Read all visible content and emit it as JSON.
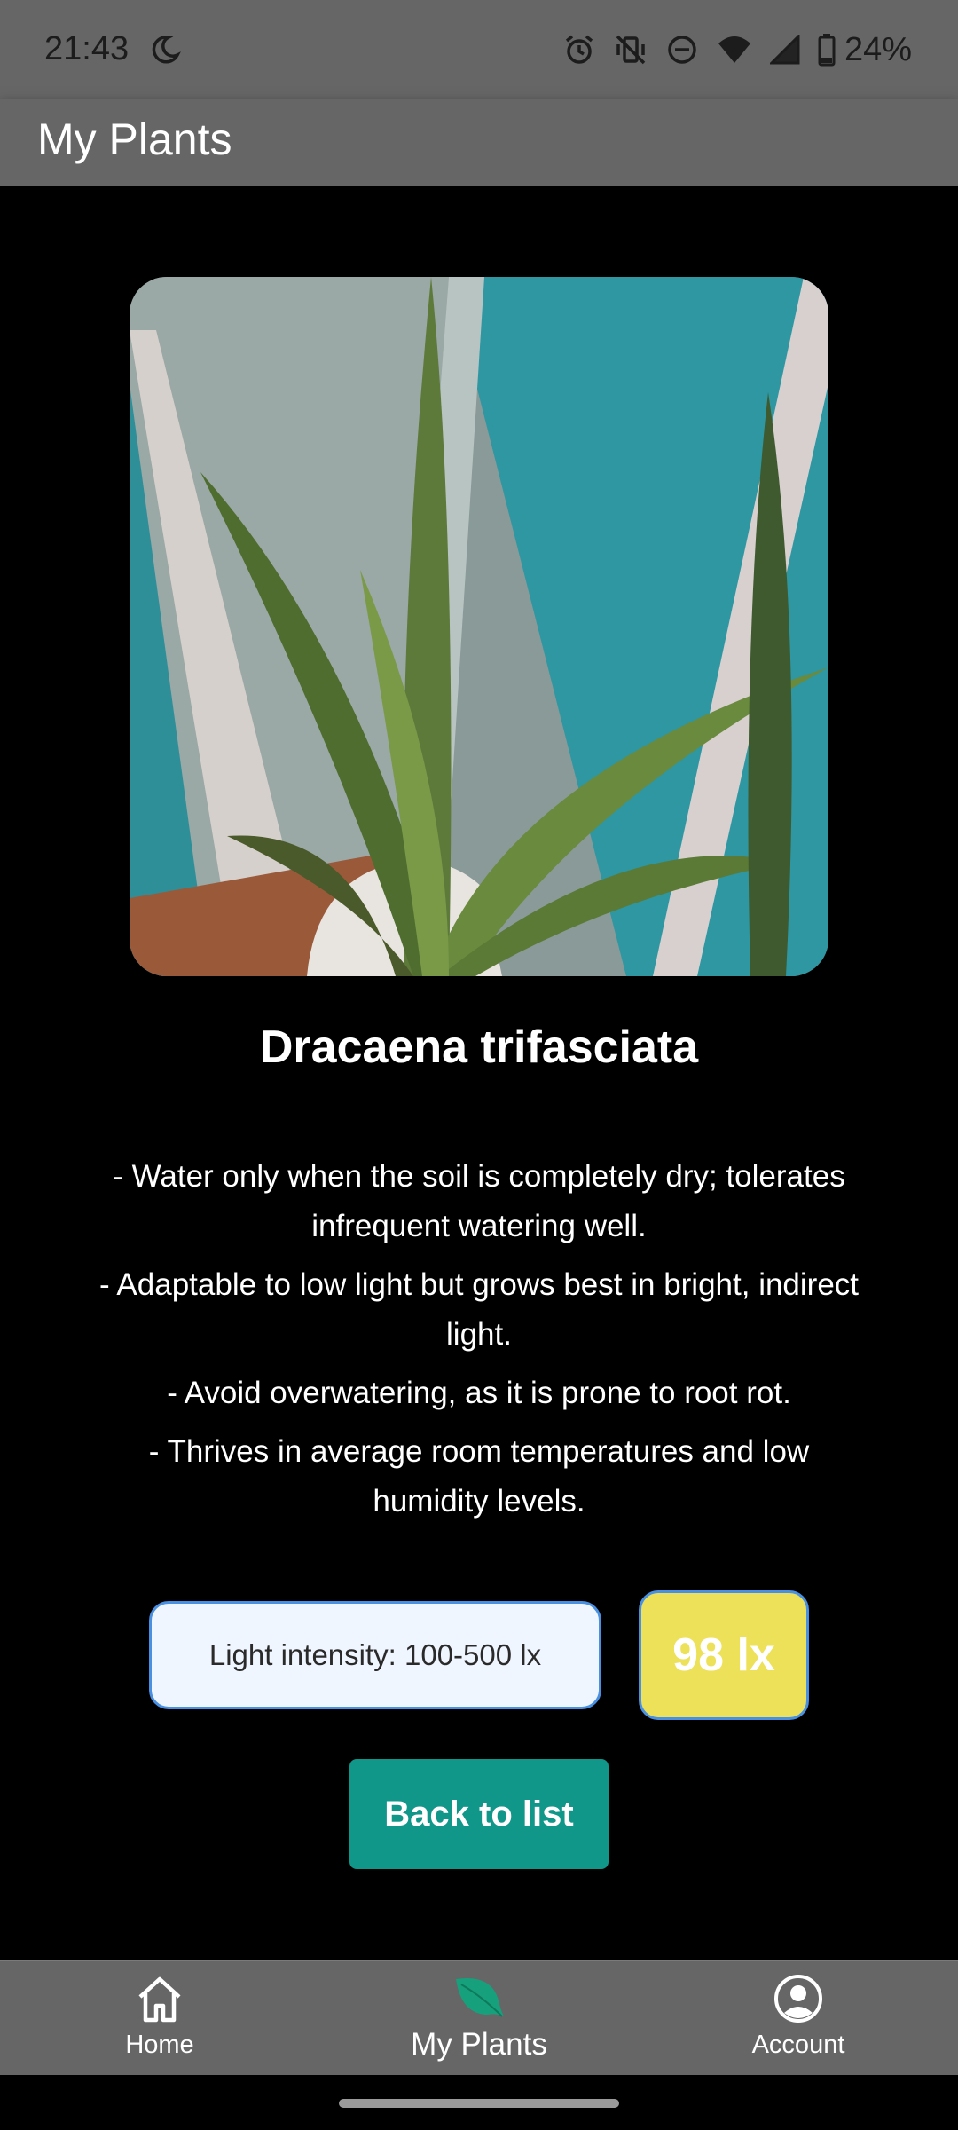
{
  "status_bar": {
    "time": "21:43",
    "battery_percent": "24%",
    "icons": [
      "do-not-disturb-moon-icon",
      "alarm-icon",
      "vibrate-off-icon",
      "dnd-minus-icon",
      "wifi-icon",
      "cellular-signal-icon",
      "battery-icon"
    ]
  },
  "app_bar": {
    "title": "My Plants"
  },
  "plant": {
    "name": "Dracaena trifasciata",
    "care": [
      "- Water only when the soil is completely dry; tolerates infrequent watering well.",
      "- Adaptable to low light but grows best in bright, indirect light.",
      "- Avoid overwatering, as it is prone to root rot.",
      "- Thrives in average room temperatures and low humidity levels."
    ],
    "light_range": "Light intensity: 100-500 lx",
    "light_reading": "98 lx"
  },
  "actions": {
    "back_label": "Back to list"
  },
  "bottom_nav": {
    "items": [
      {
        "label": "Home",
        "icon": "home-icon",
        "active": false
      },
      {
        "label": "My Plants",
        "icon": "leaf-icon",
        "active": true
      },
      {
        "label": "Account",
        "icon": "account-circle-icon",
        "active": false
      }
    ]
  },
  "colors": {
    "bar_gray": "#666666",
    "accent_teal": "#11968a",
    "reading_yellow": "#ede15a",
    "range_border_blue": "#4a90e2",
    "leaf_green": "#17a07c"
  }
}
